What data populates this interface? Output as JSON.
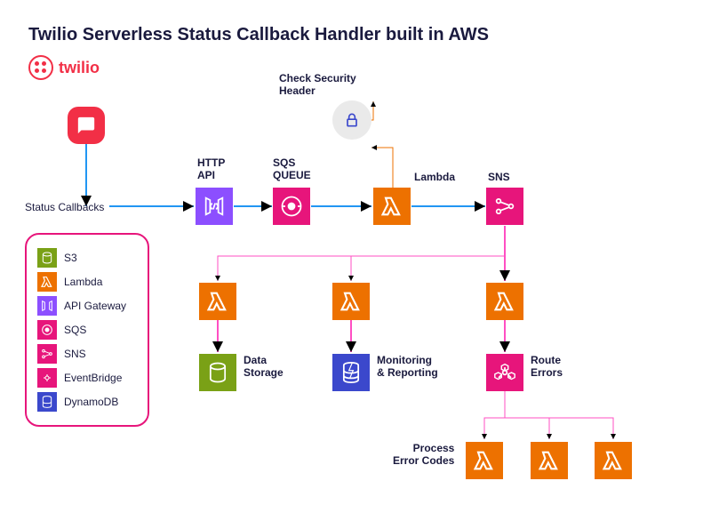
{
  "title": "Twilio Serverless Status Callback Handler built in AWS",
  "brand": "twilio",
  "labels": {
    "status_callbacks": "Status Callbacks",
    "http_api": "HTTP\nAPI",
    "sqs_queue": "SQS\nQUEUE",
    "lambda": "Lambda",
    "sns": "SNS",
    "check_security": "Check Security\nHeader",
    "data_storage": "Data\nStorage",
    "monitoring": "Monitoring\n& Reporting",
    "route_errors": "Route\nErrors",
    "process_error_codes": "Process\nError Codes"
  },
  "legend": {
    "s3": "S3",
    "lambda": "Lambda",
    "api_gateway": "API Gateway",
    "sqs": "SQS",
    "sns": "SNS",
    "eventbridge": "EventBridge",
    "dynamodb": "DynamoDB"
  },
  "colors": {
    "orange": "#ed7100",
    "purple": "#8c4fff",
    "magenta": "#e7157b",
    "green": "#7aa116",
    "blue": "#3b48cc",
    "twilio_red": "#f22f46",
    "arrow_blue": "#2196f3",
    "arrow_pink": "#ff4fc3"
  }
}
